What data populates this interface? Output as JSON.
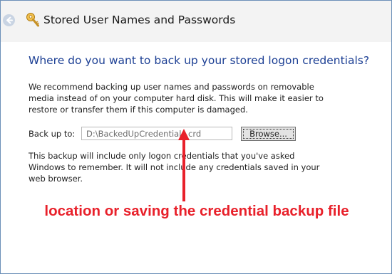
{
  "window": {
    "title": "Stored User Names and Passwords"
  },
  "main": {
    "heading": "Where do you want to back up your stored logon credentials?",
    "intro": "We recommend backing up user names and passwords on removable media instead of on your computer hard disk. This will make it easier to restore or transfer them if this computer is damaged.",
    "backup_label": "Back up to:",
    "backup_path": "D:\\BackedUpCredentials.crd",
    "browse_label": "Browse...",
    "note": "This backup will include only logon credentials that you've asked Windows to remember. It will not include any credentials saved in your web browser."
  },
  "annotation": {
    "text": "location or saving the credential backup file",
    "color": "#e8202a"
  },
  "icons": {
    "back": "back-arrow-icon",
    "title": "key-icon"
  },
  "colors": {
    "heading": "#1c3f94",
    "titlebar": "#f3f3f3"
  }
}
